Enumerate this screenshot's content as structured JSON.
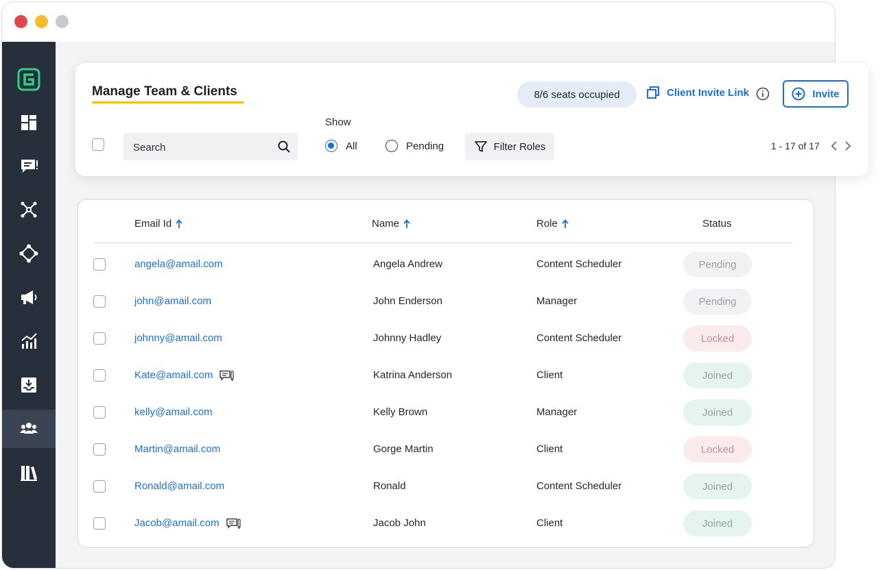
{
  "window": {
    "controls": [
      "close",
      "minimize",
      "maximize"
    ]
  },
  "sidebar": {
    "logo": "g-logo-icon",
    "items": [
      {
        "icon": "dashboard-icon",
        "active": false
      },
      {
        "icon": "message-icon",
        "active": false
      },
      {
        "icon": "network-icon",
        "active": false
      },
      {
        "icon": "connections-icon",
        "active": false
      },
      {
        "icon": "megaphone-icon",
        "active": false
      },
      {
        "icon": "analytics-icon",
        "active": false
      },
      {
        "icon": "inbox-download-icon",
        "active": false
      },
      {
        "icon": "team-icon",
        "active": true
      },
      {
        "icon": "library-icon",
        "active": false
      }
    ]
  },
  "header": {
    "title": "Manage Team & Clients",
    "seats": "8/6 seats occupied",
    "invite_link_label": "Client Invite Link",
    "invite_button_label": "Invite"
  },
  "filters": {
    "search_placeholder": "Search",
    "show_label": "Show",
    "options": [
      "All",
      "Pending"
    ],
    "selected": "All",
    "filter_roles_label": "Filter Roles",
    "pagination": "1 - 17 of 17"
  },
  "table": {
    "columns": [
      "Email Id",
      "Name",
      "Role",
      "Status"
    ],
    "rows": [
      {
        "email": "angela@amail.com",
        "name": "Angela Andrew",
        "role": "Content Scheduler",
        "status": "Pending",
        "has_note": false
      },
      {
        "email": "john@amail.com",
        "name": "John Enderson",
        "role": "Manager",
        "status": "Pending",
        "has_note": false
      },
      {
        "email": "johnny@amail.com",
        "name": "Johnny Hadley",
        "role": "Content Scheduler",
        "status": "Locked",
        "has_note": false
      },
      {
        "email": "Kate@amail.com",
        "name": "Katrina Anderson",
        "role": "Client",
        "status": "Joined",
        "has_note": true
      },
      {
        "email": "kelly@amail.com",
        "name": "Kelly Brown",
        "role": "Manager",
        "status": "Joined",
        "has_note": false
      },
      {
        "email": "Martin@amail.com",
        "name": "Gorge Martin",
        "role": "Client",
        "status": "Locked",
        "has_note": false
      },
      {
        "email": "Ronald@amail.com",
        "name": "Ronald",
        "role": "Content Scheduler",
        "status": "Joined",
        "has_note": false
      },
      {
        "email": "Jacob@amail.com",
        "name": "Jacob John",
        "role": "Client",
        "status": "Joined",
        "has_note": true
      }
    ]
  },
  "colors": {
    "accent": "#1a6fd6",
    "sidebar": "#272f3c",
    "underline": "#f5bd1a",
    "pending_bg": "#f1f2f3",
    "locked_bg": "#fcebeb",
    "joined_bg": "#e6f4ee"
  }
}
